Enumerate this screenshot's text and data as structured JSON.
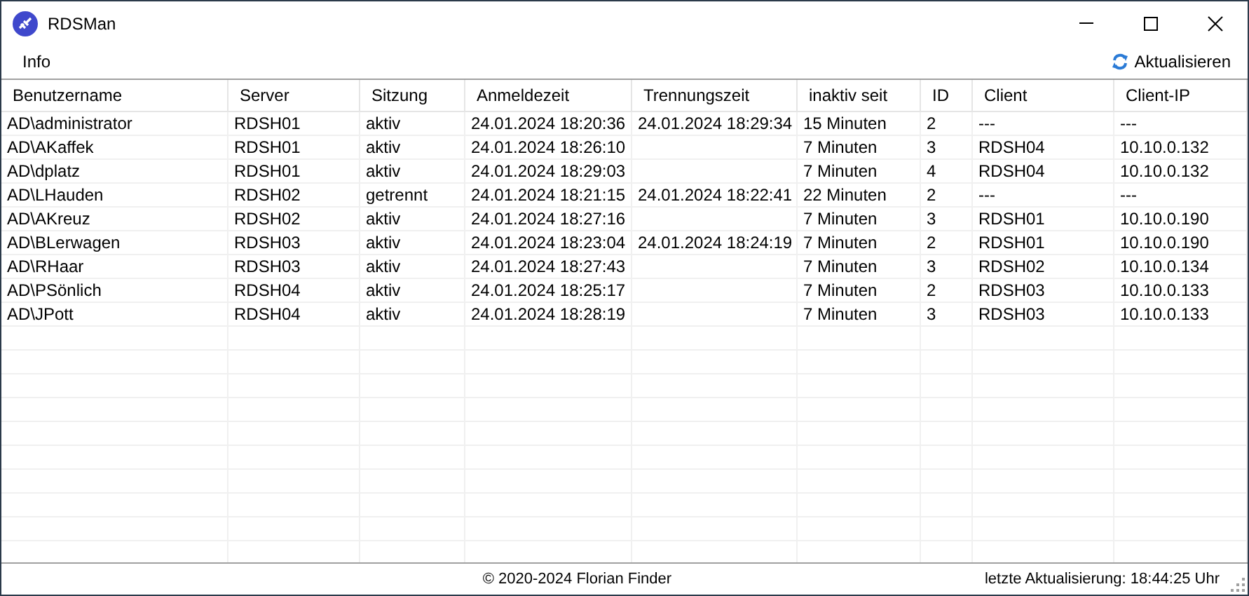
{
  "window": {
    "title": "RDSMan"
  },
  "menu": {
    "items": [
      "Info"
    ],
    "refresh_button": "Aktualisieren"
  },
  "table": {
    "columns": [
      "Benutzername",
      "Server",
      "Sitzung",
      "Anmeldezeit",
      "Trennungszeit",
      "inaktiv seit",
      "ID",
      "Client",
      "Client-IP"
    ],
    "rows": [
      {
        "cells": [
          "AD\\administrator",
          "RDSH01",
          "aktiv",
          "24.01.2024 18:20:36",
          "24.01.2024 18:29:34",
          "15 Minuten",
          "2",
          "---",
          "---"
        ]
      },
      {
        "cells": [
          "AD\\AKaffek",
          "RDSH01",
          "aktiv",
          "24.01.2024 18:26:10",
          null,
          "7 Minuten",
          "3",
          "RDSH04",
          "10.10.0.132"
        ]
      },
      {
        "cells": [
          "AD\\dplatz",
          "RDSH01",
          "aktiv",
          "24.01.2024 18:29:03",
          null,
          "7 Minuten",
          "4",
          "RDSH04",
          "10.10.0.132"
        ]
      },
      {
        "cells": [
          "AD\\LHauden",
          "RDSH02",
          "getrennt",
          "24.01.2024 18:21:15",
          "24.01.2024 18:22:41",
          "22 Minuten",
          "2",
          "---",
          "---"
        ]
      },
      {
        "cells": [
          "AD\\AKreuz",
          "RDSH02",
          "aktiv",
          "24.01.2024 18:27:16",
          null,
          "7 Minuten",
          "3",
          "RDSH01",
          "10.10.0.190"
        ]
      },
      {
        "cells": [
          "AD\\BLerwagen",
          "RDSH03",
          "aktiv",
          "24.01.2024 18:23:04",
          "24.01.2024 18:24:19",
          "7 Minuten",
          "2",
          "RDSH01",
          "10.10.0.190"
        ]
      },
      {
        "cells": [
          "AD\\RHaar",
          "RDSH03",
          "aktiv",
          "24.01.2024 18:27:43",
          null,
          "7 Minuten",
          "3",
          "RDSH02",
          "10.10.0.134"
        ]
      },
      {
        "cells": [
          "AD\\PSönlich",
          "RDSH04",
          "aktiv",
          "24.01.2024 18:25:17",
          null,
          "7 Minuten",
          "2",
          "RDSH03",
          "10.10.0.133"
        ]
      },
      {
        "cells": [
          "AD\\JPott",
          "RDSH04",
          "aktiv",
          "24.01.2024 18:28:19",
          null,
          "7 Minuten",
          "3",
          "RDSH03",
          "10.10.0.133"
        ]
      }
    ]
  },
  "status_bar": {
    "copyright": "© 2020-2024 Florian Finder",
    "last_update": "letzte Aktualisierung: 18:44:25 Uhr"
  }
}
